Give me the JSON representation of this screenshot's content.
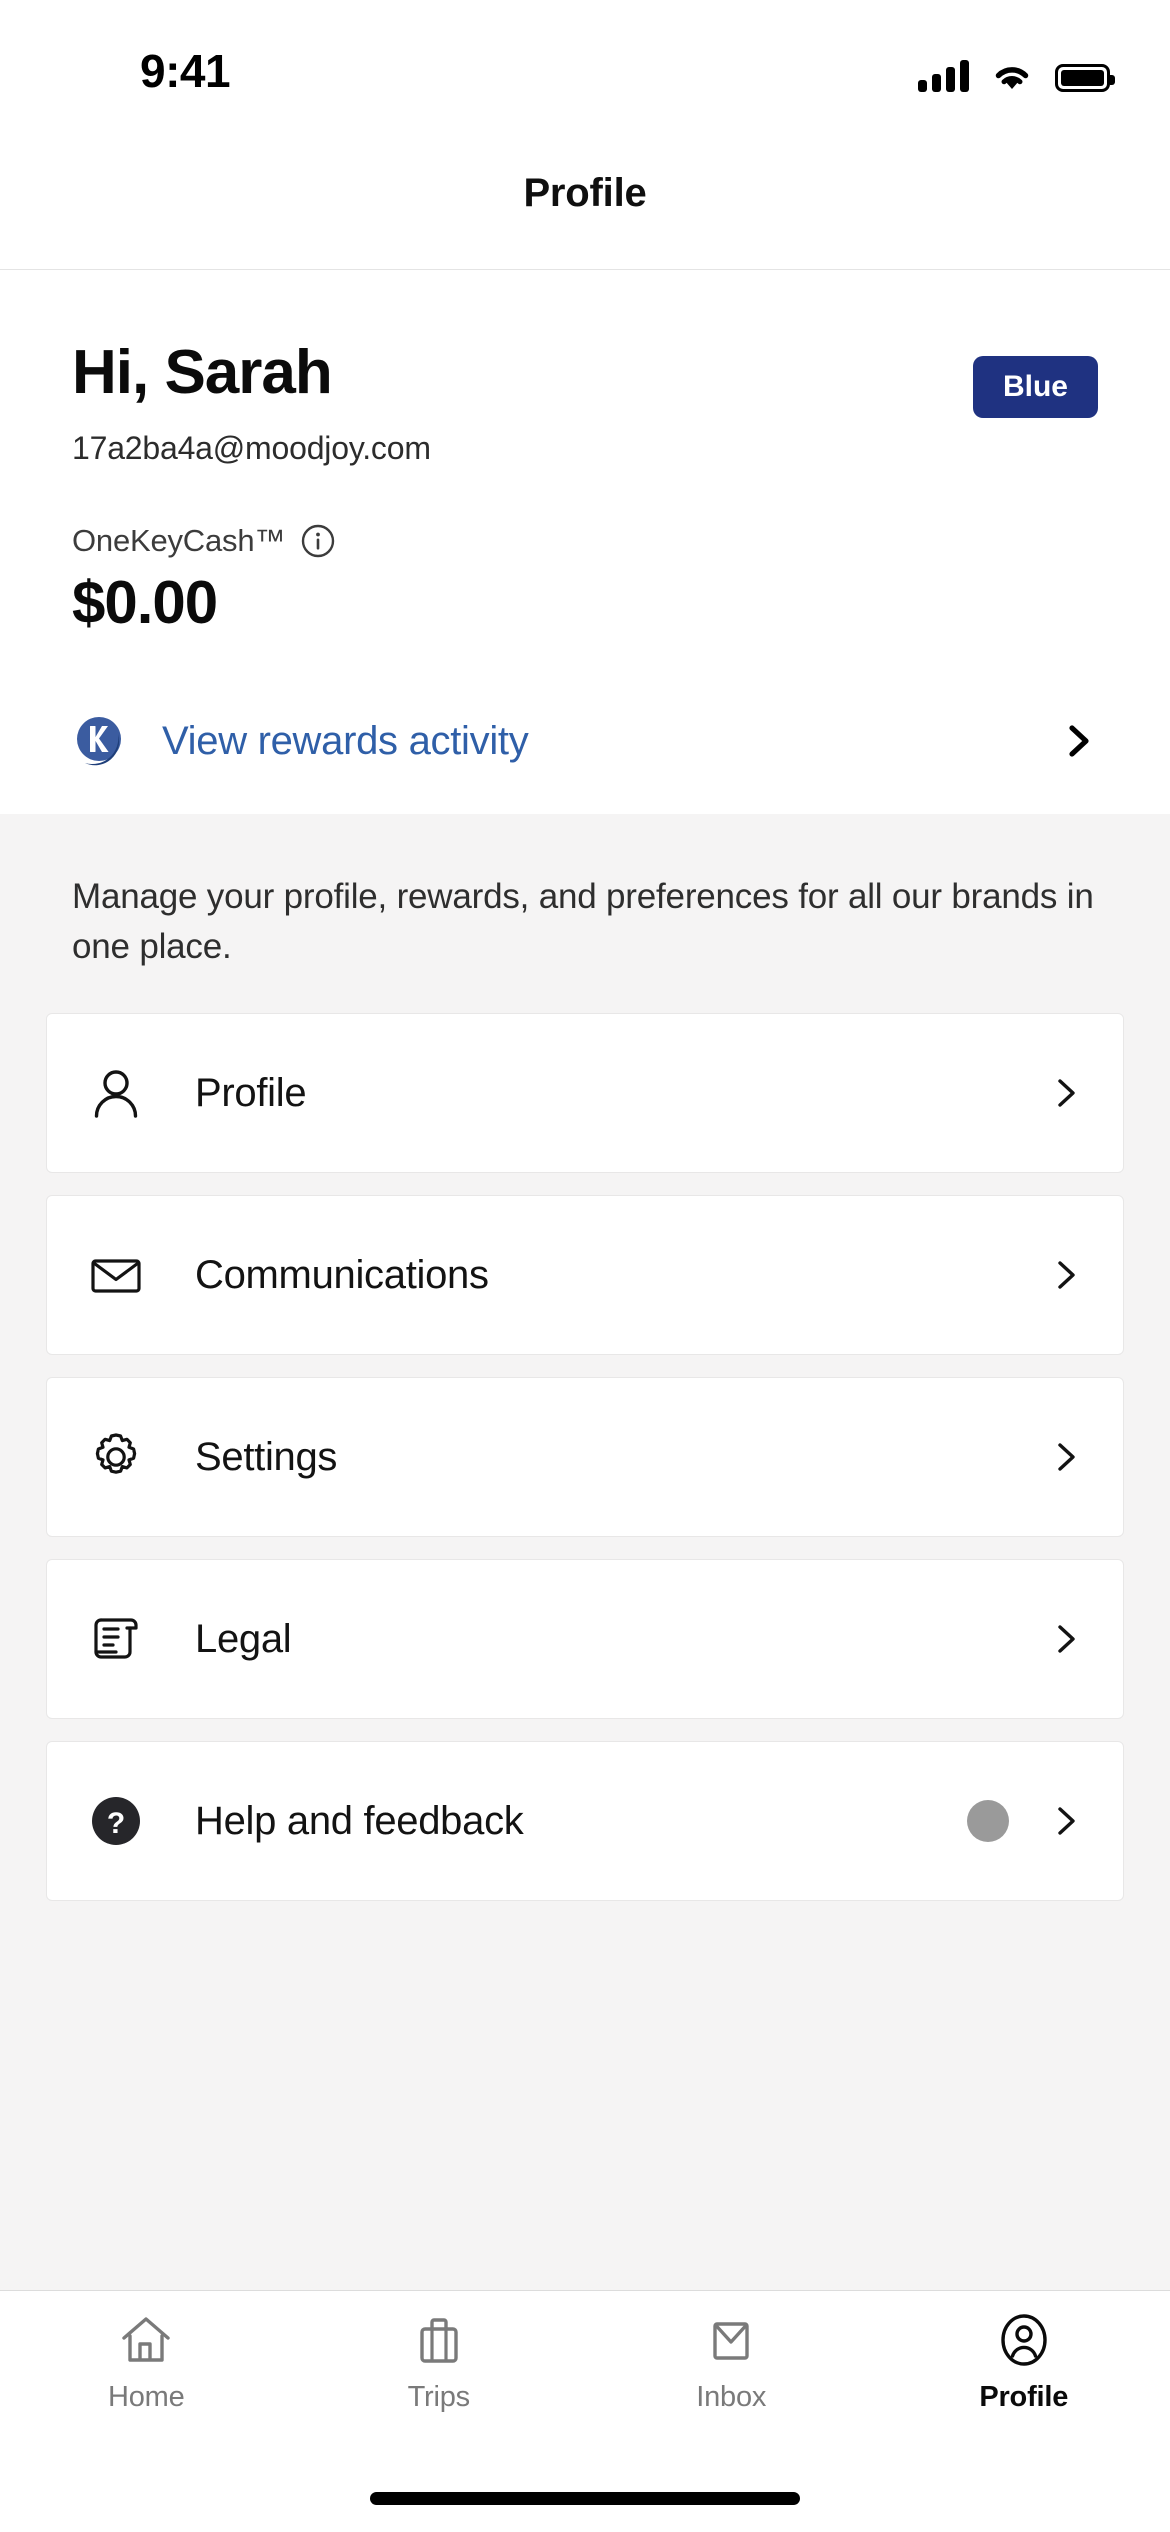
{
  "status_bar": {
    "time": "9:41",
    "signal_icon": "cellular-signal-icon",
    "wifi_icon": "wifi-icon",
    "battery_icon": "battery-full-icon"
  },
  "header": {
    "title": "Profile"
  },
  "account": {
    "greeting": "Hi, Sarah",
    "email": "17a2ba4a@moodjoy.com",
    "tier_badge": "Blue",
    "tier_badge_color": "#1f3281",
    "rewards_program_label": "OneKeyCash™",
    "info_icon": "info-circle-icon",
    "rewards_balance": "$0.00",
    "rewards_link_label": "View rewards activity",
    "rewards_link_color": "#2f5fa8",
    "onekey_logo_icon": "onekey-k-logo-icon",
    "rewards_chevron_icon": "chevron-right-icon"
  },
  "menu": {
    "description": "Manage your profile, rewards, and preferences for all our brands in one place.",
    "items": [
      {
        "label": "Profile",
        "icon": "person-icon",
        "chevron": "chevron-right-icon",
        "has_dot": false
      },
      {
        "label": "Communications",
        "icon": "envelope-icon",
        "chevron": "chevron-right-icon",
        "has_dot": false
      },
      {
        "label": "Settings",
        "icon": "gear-icon",
        "chevron": "chevron-right-icon",
        "has_dot": false
      },
      {
        "label": "Legal",
        "icon": "document-scroll-icon",
        "chevron": "chevron-right-icon",
        "has_dot": false
      },
      {
        "label": "Help and feedback",
        "icon": "question-mark-circle-icon",
        "chevron": "chevron-right-icon",
        "has_dot": true,
        "dot_color": "#9a9a9a"
      }
    ]
  },
  "tab_bar": {
    "tabs": [
      {
        "label": "Home",
        "icon": "house-icon",
        "active": false
      },
      {
        "label": "Trips",
        "icon": "suitcase-icon",
        "active": false
      },
      {
        "label": "Inbox",
        "icon": "envelope-icon",
        "active": false
      },
      {
        "label": "Profile",
        "icon": "person-circle-icon",
        "active": true
      }
    ],
    "inactive_color": "#7a7a7a",
    "active_color": "#0b0b0b"
  },
  "home_indicator": "home-indicator-bar"
}
